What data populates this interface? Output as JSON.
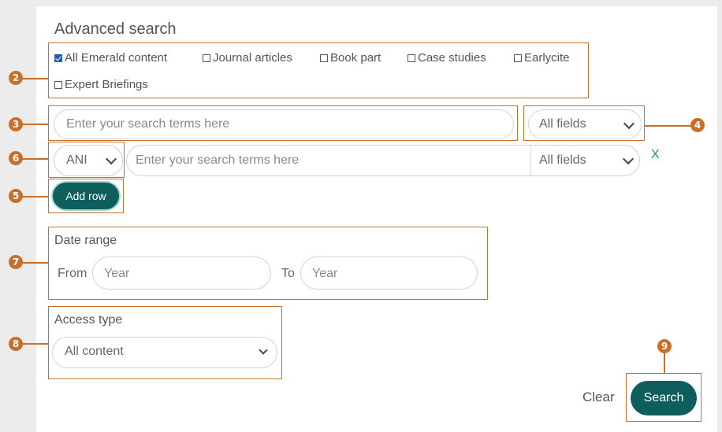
{
  "title": "Advanced search",
  "content_types": [
    {
      "label": "All Emerald content",
      "checked": true
    },
    {
      "label": "Journal articles",
      "checked": false
    },
    {
      "label": "Book part",
      "checked": false
    },
    {
      "label": "Case studies",
      "checked": false
    },
    {
      "label": "Earlycite",
      "checked": false
    },
    {
      "label": "Expert Briefings",
      "checked": false
    }
  ],
  "search_row1": {
    "placeholder": "Enter your search terms here",
    "field": "All fields"
  },
  "search_row2": {
    "operator": "AND",
    "operator_shown": "ANI",
    "placeholder": "Enter your search terms here",
    "field": "All fields",
    "remove": "X"
  },
  "add_row": "Add row",
  "date_range": {
    "label": "Date range",
    "from_label": "From",
    "to_label": "To",
    "from_placeholder": "Year",
    "to_placeholder": "Year"
  },
  "access_type": {
    "label": "Access type",
    "value": "All content"
  },
  "actions": {
    "clear": "Clear",
    "search": "Search"
  },
  "callouts": [
    "2",
    "3",
    "4",
    "5",
    "6",
    "7",
    "8",
    "9"
  ],
  "colors": {
    "annotation": "#c8702a",
    "button": "#0e5e5e",
    "remove_x": "#1b8a8a",
    "checkbox": "#1f5fb2"
  }
}
